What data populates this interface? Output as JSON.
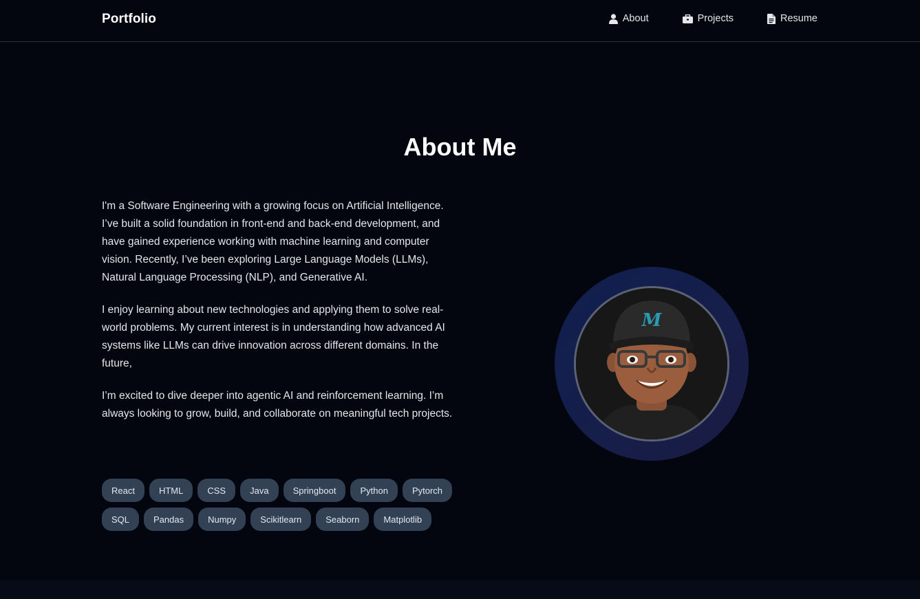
{
  "nav": {
    "brand": "Portfolio",
    "links": [
      {
        "label": "About",
        "icon": "user-icon"
      },
      {
        "label": "Projects",
        "icon": "briefcase-icon"
      },
      {
        "label": "Resume",
        "icon": "document-icon"
      }
    ]
  },
  "about": {
    "title": "About Me",
    "paragraphs": [
      "I'm a Software Engineering with a growing focus on Artificial Intelligence. I’ve built a solid foundation in front-end and back-end development, and have gained experience working with machine learning and computer vision. Recently, I’ve been exploring Large Language Models (LLMs), Natural Language Processing (NLP), and Generative AI.",
      "I enjoy learning about new technologies and applying them to solve real-world problems. My current interest is in understanding how advanced AI systems like LLMs can drive innovation across different domains. In the future,",
      "I’m excited to dive deeper into agentic AI and reinforcement learning. I’m always looking to grow, build, and collaborate on meaningful tech projects."
    ],
    "skills": [
      "React",
      "HTML",
      "CSS",
      "Java",
      "Springboot",
      "Python",
      "Pytorch",
      "SQL",
      "Pandas",
      "Numpy",
      "Scikitlearn",
      "Seaborn",
      "Matplotlib"
    ]
  },
  "avatar": {
    "icon": "avatar-image"
  },
  "colors": {
    "background": "#03050f",
    "chip": "#334155",
    "ring": "#102050",
    "nav_border": "#2c313c"
  }
}
